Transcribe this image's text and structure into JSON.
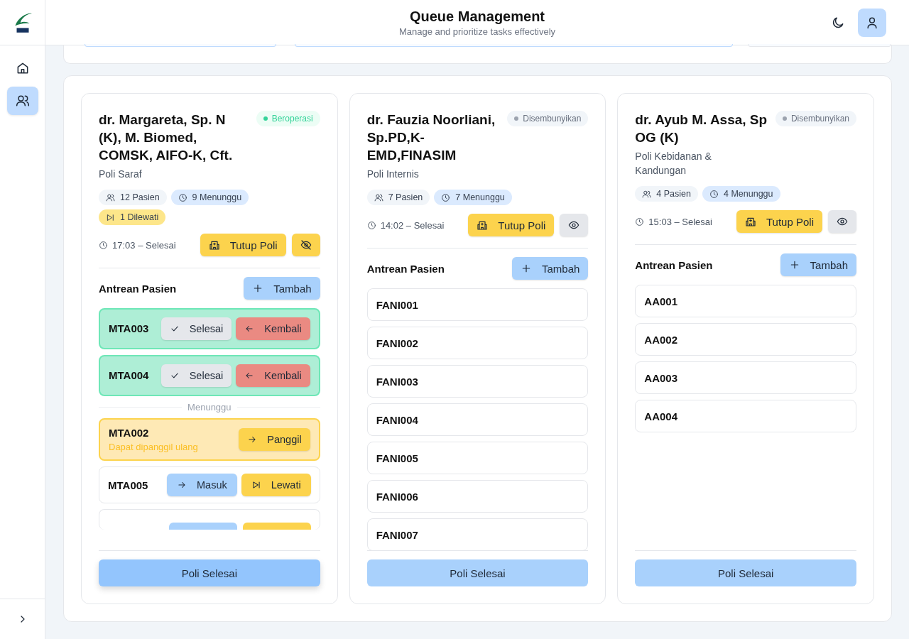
{
  "header": {
    "title": "Queue Management",
    "subtitle": "Manage and prioritize tasks effectively"
  },
  "sidebar": {
    "items": [
      {
        "kind": "home",
        "selected": false
      },
      {
        "kind": "people",
        "selected": true
      }
    ]
  },
  "cards": [
    {
      "doctor": "dr. Margareta, Sp. N (K), M. Biomed, COMSK, AIFO-K, Cft.",
      "status": {
        "kind": "operating",
        "label": "Beroperasi"
      },
      "clinic": "Poli Saraf",
      "stats": [
        {
          "kind": "patients",
          "label": "12 Pasien"
        },
        {
          "kind": "waiting",
          "label": "9 Menunggu"
        },
        {
          "kind": "skipped",
          "label": "1 Dilewati"
        }
      ],
      "time": "17:03 – Selesai",
      "close_label": "Tutup Poli",
      "visible": true,
      "section": "Antrean Pasien",
      "add_label": "Tambah",
      "queue": [
        {
          "kind": "called",
          "code": "MTA003",
          "actions": [
            "Selesai",
            "Kembali"
          ]
        },
        {
          "kind": "called",
          "code": "MTA004",
          "actions": [
            "Selesai",
            "Kembali"
          ]
        },
        {
          "kind": "divider",
          "label": "Menunggu"
        },
        {
          "kind": "skipped",
          "code": "MTA002",
          "note": "Dapat dipanggil ulang",
          "actions": [
            "Panggil"
          ]
        },
        {
          "kind": "waiting",
          "code": "MTA005",
          "actions": [
            "Masuk",
            "Lewati"
          ]
        },
        {
          "kind": "cut"
        }
      ],
      "finish_label": "Poli Selesai",
      "finish_enabled": true
    },
    {
      "doctor": "dr. Fauzia Noorliani, Sp.PD,K-EMD,FINASIM",
      "status": {
        "kind": "hidden",
        "label": "Disembunyikan"
      },
      "clinic": "Poli Internis",
      "stats": [
        {
          "kind": "patients",
          "label": "7 Pasien"
        },
        {
          "kind": "waiting",
          "label": "7 Menunggu"
        }
      ],
      "time": "14:02 – Selesai",
      "close_label": "Tutup Poli",
      "visible": false,
      "section": "Antrean Pasien",
      "add_label": "Tambah",
      "queue": [
        {
          "kind": "plain",
          "code": "FANI001"
        },
        {
          "kind": "plain",
          "code": "FANI002"
        },
        {
          "kind": "plain",
          "code": "FANI003"
        },
        {
          "kind": "plain",
          "code": "FANI004"
        },
        {
          "kind": "plain",
          "code": "FANI005"
        },
        {
          "kind": "plain",
          "code": "FANI006"
        },
        {
          "kind": "plain",
          "code": "FANI007"
        }
      ],
      "finish_label": "Poli Selesai",
      "finish_enabled": false
    },
    {
      "doctor": "dr. Ayub M. Assa, Sp OG (K)",
      "status": {
        "kind": "hidden",
        "label": "Disembunyikan"
      },
      "clinic": "Poli Kebidanan & Kandungan",
      "stats": [
        {
          "kind": "patients",
          "label": "4 Pasien"
        },
        {
          "kind": "waiting",
          "label": "4 Menunggu"
        }
      ],
      "time": "15:03 – Selesai",
      "close_label": "Tutup Poli",
      "visible": false,
      "section": "Antrean Pasien",
      "add_label": "Tambah",
      "queue": [
        {
          "kind": "plain",
          "code": "AA001"
        },
        {
          "kind": "plain",
          "code": "AA002"
        },
        {
          "kind": "plain",
          "code": "AA003"
        },
        {
          "kind": "plain",
          "code": "AA004"
        }
      ],
      "finish_label": "Poli Selesai",
      "finish_enabled": false
    }
  ]
}
